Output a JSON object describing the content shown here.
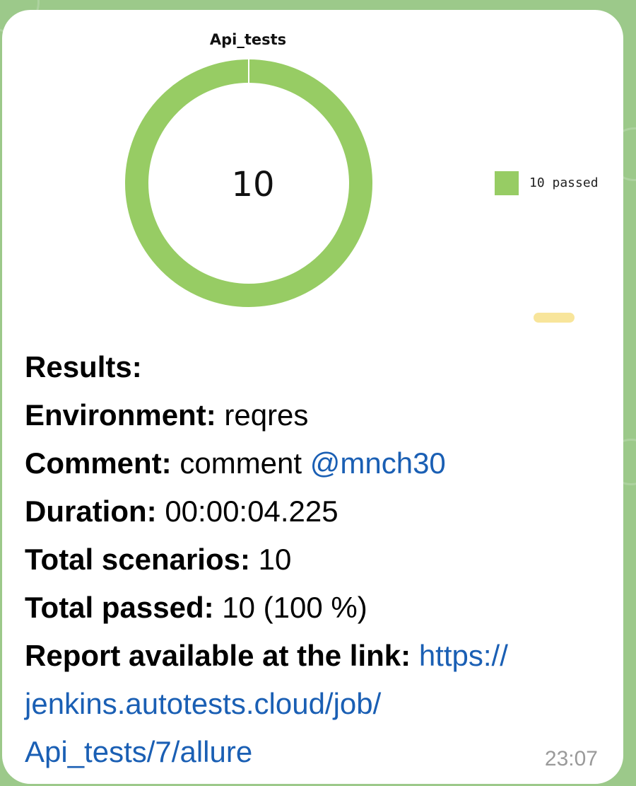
{
  "chart_data": {
    "type": "pie",
    "title": "Api_tests",
    "center_label": "10",
    "categories": [
      "passed"
    ],
    "values": [
      10
    ],
    "colors": [
      "#97cc64"
    ],
    "legend": [
      "10 passed"
    ],
    "legend_position": "right"
  },
  "message": {
    "results_label": "Results:",
    "environment_label": "Environment:",
    "environment_value": "reqres",
    "comment_label": "Comment:",
    "comment_value": "comment",
    "comment_mention": "@mnch30",
    "duration_label": "Duration:",
    "duration_value": "00:00:04.225",
    "scenarios_label": "Total scenarios:",
    "scenarios_value": "10",
    "passed_label": "Total passed:",
    "passed_value": "10 (100 %)",
    "report_label": "Report available at the link:",
    "report_url_line1": "https://",
    "report_url_line2": "jenkins.autotests.cloud/job/",
    "report_url_line3": "Api_tests/7/allure",
    "time": "23:07"
  },
  "colors": {
    "accent_link": "#1a5fb4",
    "passed_green": "#97cc64",
    "chat_background": "#9cc98a"
  }
}
